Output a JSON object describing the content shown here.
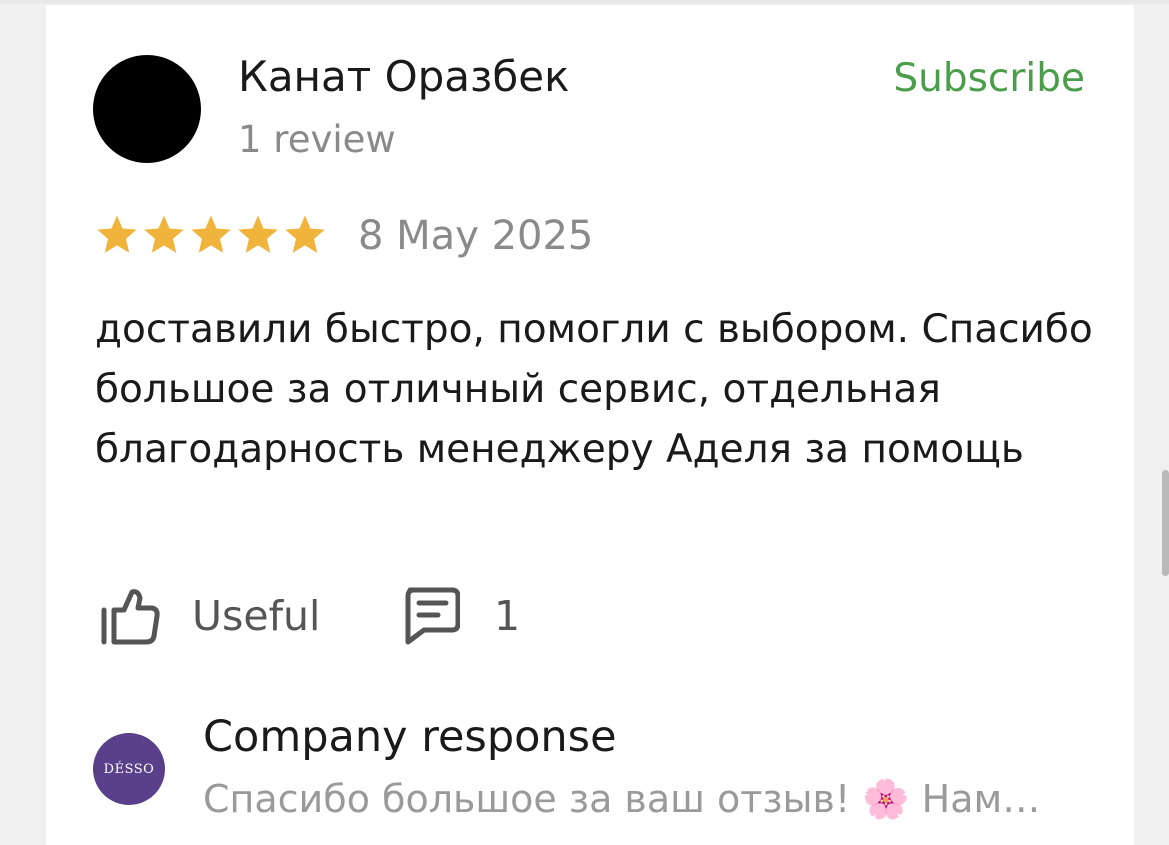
{
  "review": {
    "author_name": "Канат Оразбек",
    "review_count": "1 review",
    "subscribe_label": "Subscribe",
    "rating": 5,
    "rating_max": 5,
    "date": "8 May 2025",
    "text": "доставили быстро, помогли с выбором. Спасибо большое за отличный сервис, отдельная благодарность менеджеру Аделя за помощь",
    "useful_label": "Useful",
    "comments_count": "1"
  },
  "company_response": {
    "logo_text": "DÉSSO",
    "title": "Company response",
    "text": "Спасибо большое за ваш отзыв! 🌸 Нам…"
  },
  "colors": {
    "subscribe": "#4a9e4a",
    "star": "#f0b43c",
    "company_logo_bg": "#5a3f8a"
  },
  "icons": {
    "like": "thumbs-up-icon",
    "comment": "comment-icon",
    "star": "star-icon"
  }
}
